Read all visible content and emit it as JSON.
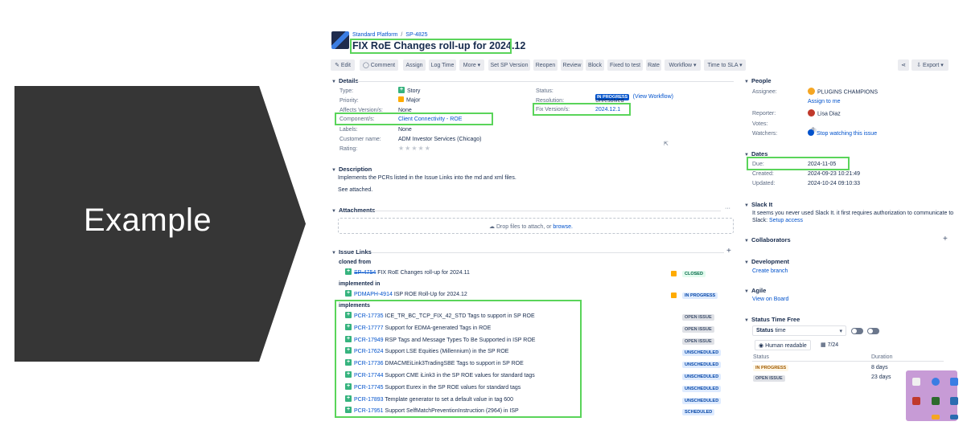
{
  "slide": {
    "label": "Example"
  },
  "breadcrumb": {
    "project": "Standard Platform",
    "separator": "/",
    "issue_key": "SP-4825"
  },
  "issue": {
    "title": "FIX RoE Changes roll-up for 2024.12"
  },
  "toolbar": {
    "edit": "✎ Edit",
    "comment": "◯ Comment",
    "assign": "Assign",
    "log_time": "Log Time",
    "more": "More ▾",
    "set_sp_version": "Set SP Version",
    "reopen": "Reopen",
    "review": "Review",
    "block": "Block",
    "fixed_to_test": "Fixed to test",
    "rate": "Rate",
    "workflow": "Workflow ▾",
    "time_to_sla": "Time to SLA ▾",
    "share_icon": "share-icon",
    "export": "⇩ Export ▾"
  },
  "details": {
    "heading": "Details",
    "type_label": "Type:",
    "type_value": "Story",
    "priority_label": "Priority:",
    "priority_value": "Major",
    "affects_label": "Affects Version/s:",
    "affects_value": "None",
    "component_label": "Component/s:",
    "component_value": "Client Connectivity - ROE",
    "labels_label": "Labels:",
    "labels_value": "None",
    "customer_label": "Customer name:",
    "customer_value": "ADM Investor Services (Chicago)",
    "rating_label": "Rating:",
    "rating_value": "★★★★★",
    "status_label": "Status:",
    "status_value": "IN PROGRESS",
    "view_workflow": "(View Workflow)",
    "resolution_label": "Resolution:",
    "resolution_value": "Unresolved",
    "fix_label": "Fix Version/s:",
    "fix_value": "2024.12.1"
  },
  "description": {
    "heading": "Description",
    "line1": "Implements the PCRs listed in the Issue Links into the md and xml files.",
    "line2": "See attached."
  },
  "attachments": {
    "heading": "Attachments",
    "more": "···",
    "drop_text": "Drop files to attach, or",
    "browse": "browse."
  },
  "issue_links": {
    "heading": "Issue Links",
    "add": "+",
    "cloned_from_label": "cloned from",
    "cloned_from": {
      "key": "SP-4754",
      "summary": "FIX RoE Changes roll-up for 2024.11",
      "status": "CLOSED"
    },
    "implemented_in_label": "implemented in",
    "implemented_in": {
      "key": "PDMAPH-4914",
      "summary": "ISP ROE Roll-Up for 2024.12",
      "status": "IN PROGRESS"
    },
    "implements_label": "implements",
    "implements": [
      {
        "key": "PCR-17735",
        "summary": "ICE_TR_BC_TCP_FIX_42_STD Tags to support in SP ROE",
        "status": "OPEN ISSUE"
      },
      {
        "key": "PCR-17777",
        "summary": "Support for EDMA-generated Tags in ROE",
        "status": "OPEN ISSUE"
      },
      {
        "key": "PCR-17949",
        "summary": "RSP Tags and Message Types To Be Supported in ISP ROE",
        "status": "OPEN ISSUE"
      },
      {
        "key": "PCR-17624",
        "summary": "Support LSE Equities (Millennium) in the SP ROE",
        "status": "UNSCHEDULED"
      },
      {
        "key": "PCR-17736",
        "summary": "DMACMEiLink3TradingSBE Tags to support in SP ROE",
        "status": "UNSCHEDULED"
      },
      {
        "key": "PCR-17744",
        "summary": "Support CME iLink3 in the SP ROE values for standard tags",
        "status": "UNSCHEDULED"
      },
      {
        "key": "PCR-17745",
        "summary": "Support Eurex in the SP ROE values for standard tags",
        "status": "UNSCHEDULED"
      },
      {
        "key": "PCR-17893",
        "summary": "Template generator to set a default value in tag 600",
        "status": "UNSCHEDULED"
      },
      {
        "key": "PCR-17951",
        "summary": "Support SelfMatchPreventionInstruction (2964) in ISP",
        "status": "SCHEDULED"
      }
    ]
  },
  "people": {
    "heading": "People",
    "assignee_label": "Assignee:",
    "assignee_value": "PLUGINS CHAMPIONS",
    "assign_to_me": "Assign to me",
    "reporter_label": "Reporter:",
    "reporter_value": "Lisa Diaz",
    "votes_label": "Votes:",
    "votes_value": "0",
    "watchers_label": "Watchers:",
    "watchers_value": "Stop watching this issue"
  },
  "dates": {
    "heading": "Dates",
    "due_label": "Due:",
    "due_value": "2024-11-05",
    "created_label": "Created:",
    "created_value": "2024-09-23 10:21:49",
    "updated_label": "Updated:",
    "updated_value": "2024-10-24 09:10:33"
  },
  "slack": {
    "heading": "Slack It",
    "text": "It seems you never used Slack It. it first requires authorization to communicate to",
    "text2": "Slack:",
    "setup": "Setup access"
  },
  "collaborators": {
    "heading": "Collaborators",
    "add": "+"
  },
  "development": {
    "heading": "Development",
    "link": "Create branch"
  },
  "agile": {
    "heading": "Agile",
    "link": "View on Board"
  },
  "status_time": {
    "heading": "Status Time Free",
    "dropdown_bold": "Status",
    "dropdown_rest": "time",
    "dropdown_arrow": "▾",
    "human_readable": "Human readable",
    "period": "7/24",
    "col_status": "Status",
    "col_duration": "Duration",
    "rows": [
      {
        "status": "IN PROGRESS",
        "duration": "8 days"
      },
      {
        "status": "OPEN ISSUE",
        "duration": "23 days"
      }
    ]
  },
  "colors": {
    "highlight": "#5ad45a",
    "link": "#0052cc",
    "arrow": "#363636"
  }
}
